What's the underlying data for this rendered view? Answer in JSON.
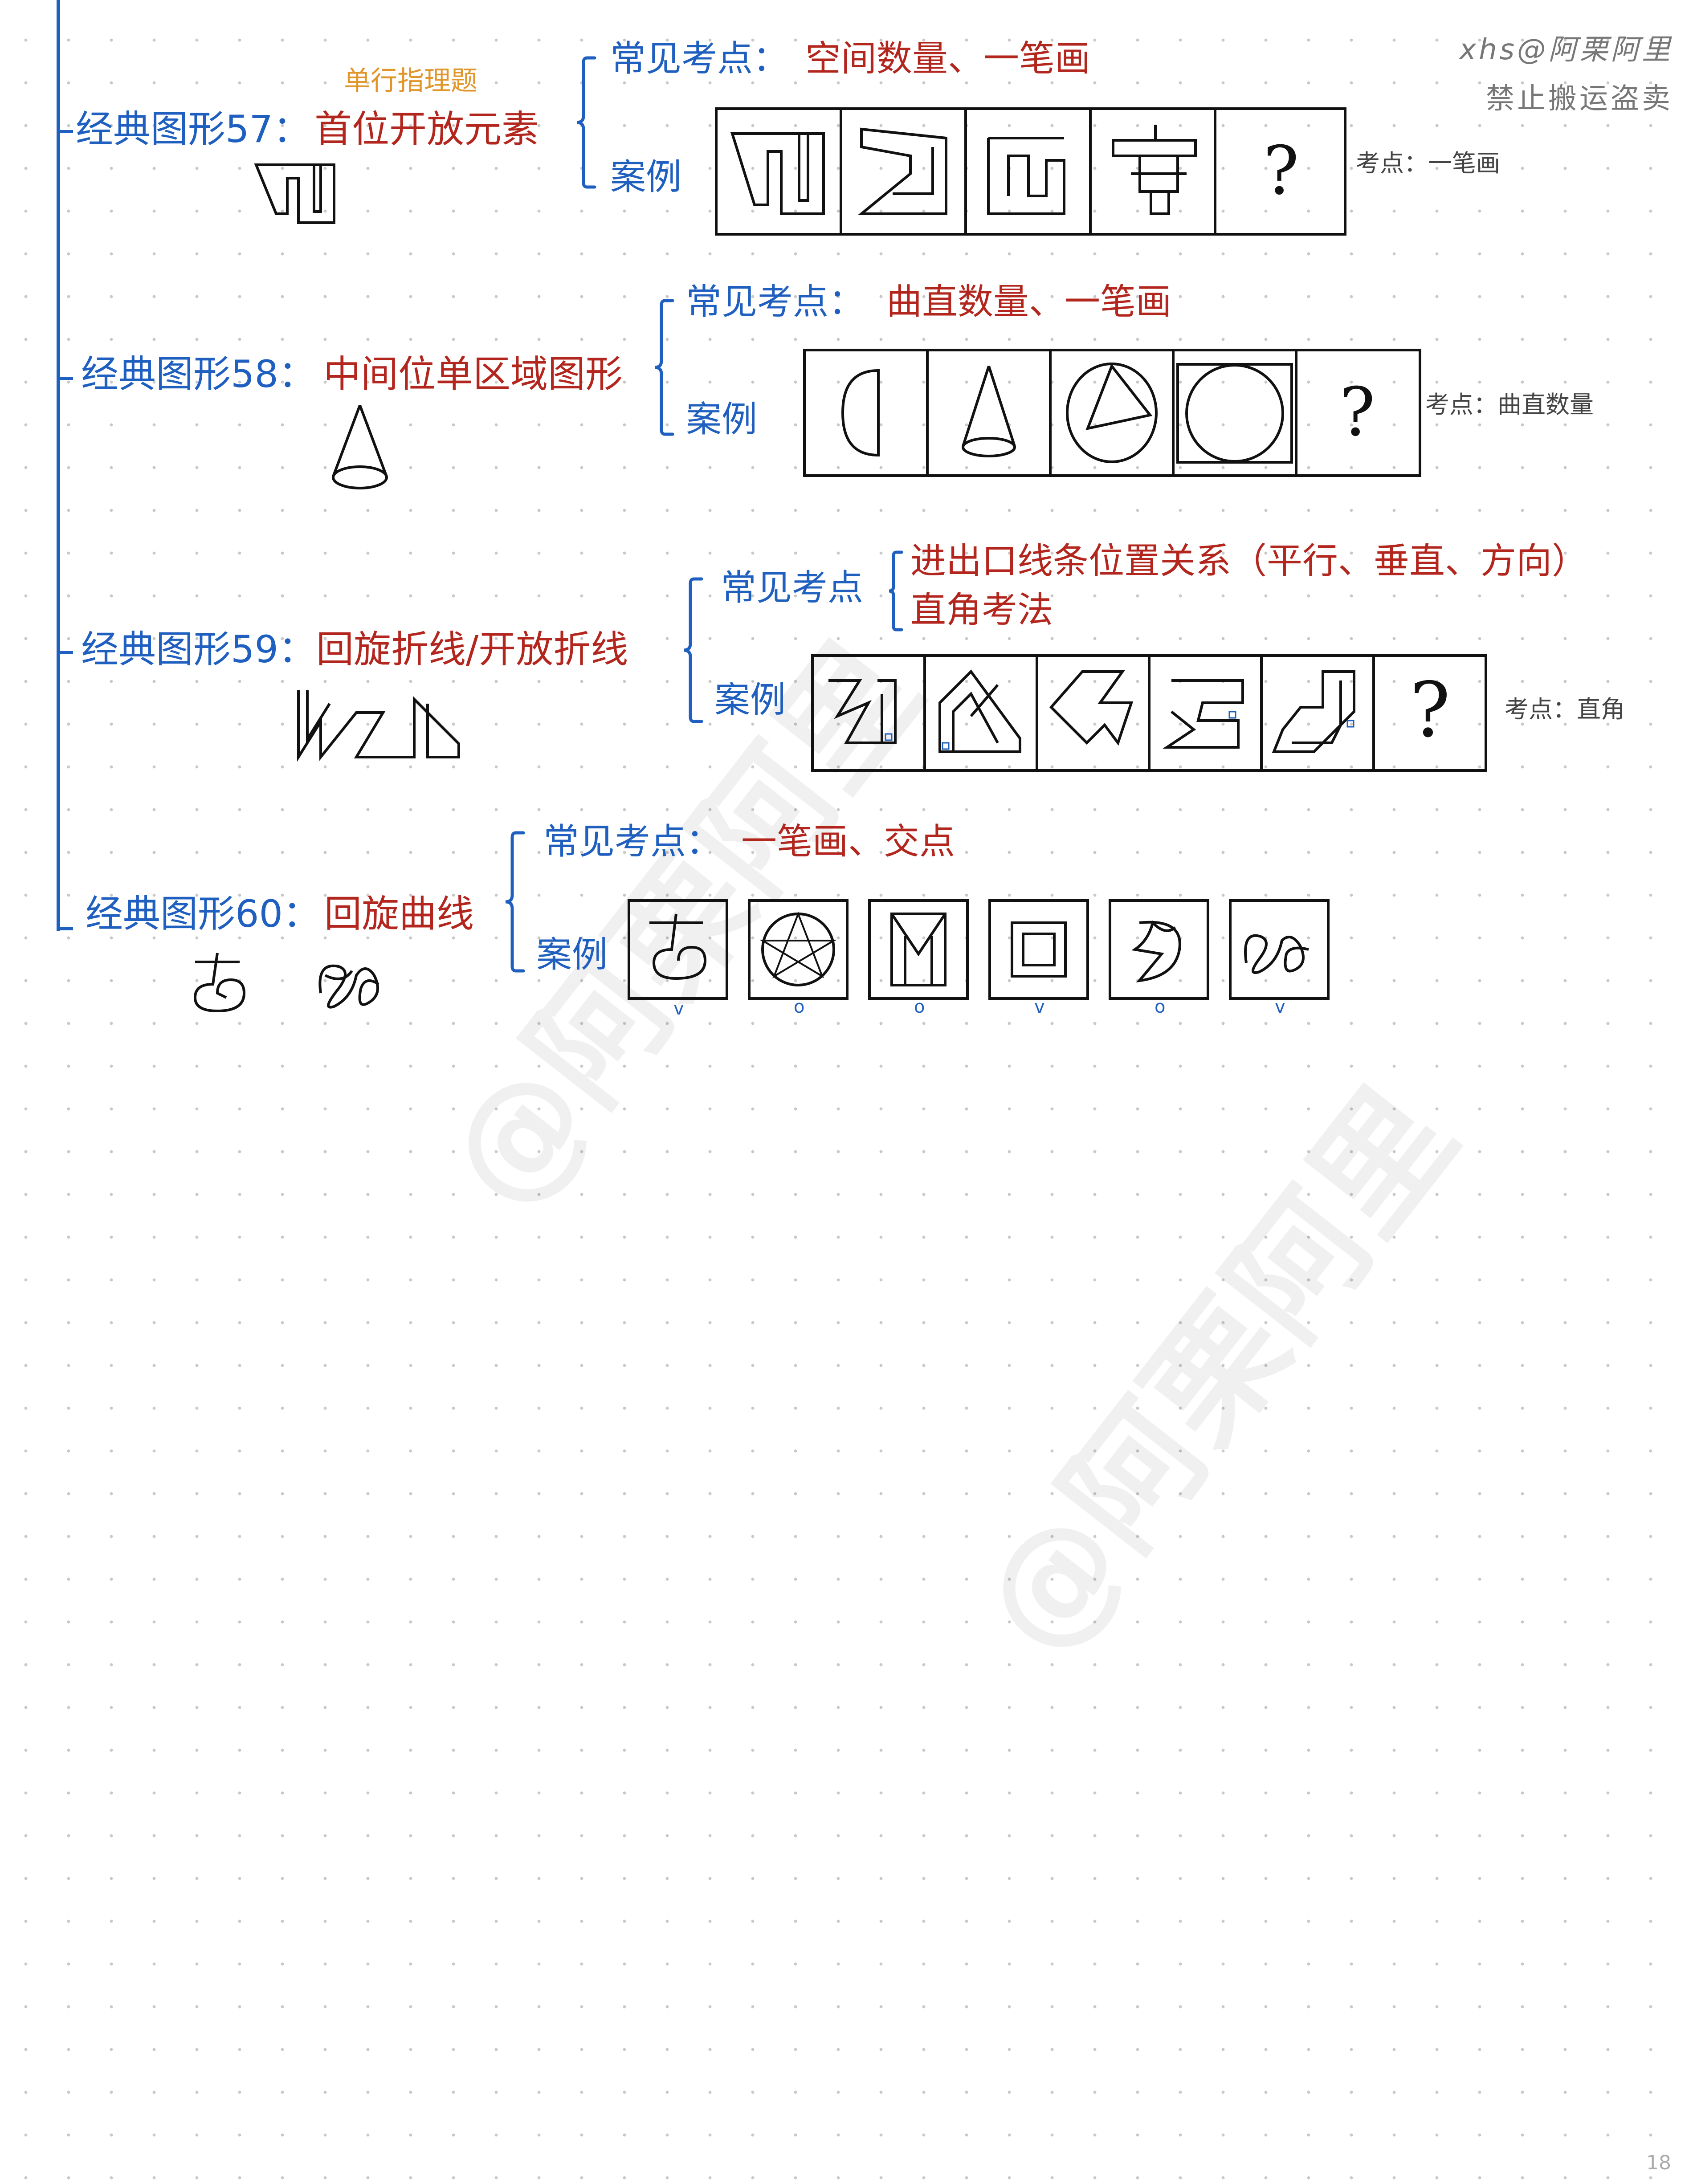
{
  "watermark": {
    "corner_line1": "xhs@阿栗阿里",
    "corner_line2": "禁止搬运盗卖",
    "diagonal": "@阿栗阿里"
  },
  "page_number": "18",
  "sections": [
    {
      "title_prefix": "经典图形57：",
      "title_main": "首位开放元素",
      "tag": "单行指理题",
      "point_label": "常见考点：",
      "point_value": "空间数量、一笔画",
      "case_label": "案例",
      "note": "考点：一笔画",
      "question": "?"
    },
    {
      "title_prefix": "经典图形58：",
      "title_main": "中间位单区域图形",
      "point_label": "常见考点：",
      "point_value": "曲直数量、一笔画",
      "case_label": "案例",
      "note": "考点：曲直数量",
      "question": "?"
    },
    {
      "title_prefix": "经典图形59：",
      "title_main": "回旋折线/开放折线",
      "point_label": "常见考点",
      "point_value_line1": "进出口线条位置关系（平行、垂直、方向）",
      "point_value_line2": "直角考法",
      "case_label": "案例",
      "note": "考点：直角",
      "question": "?"
    },
    {
      "title_prefix": "经典图形60：",
      "title_main": "回旋曲线",
      "point_label": "常见考点：",
      "point_value": "一笔画、交点",
      "case_label": "案例",
      "marks": [
        "v",
        "o",
        "o",
        "v",
        "o",
        "v"
      ]
    }
  ]
}
